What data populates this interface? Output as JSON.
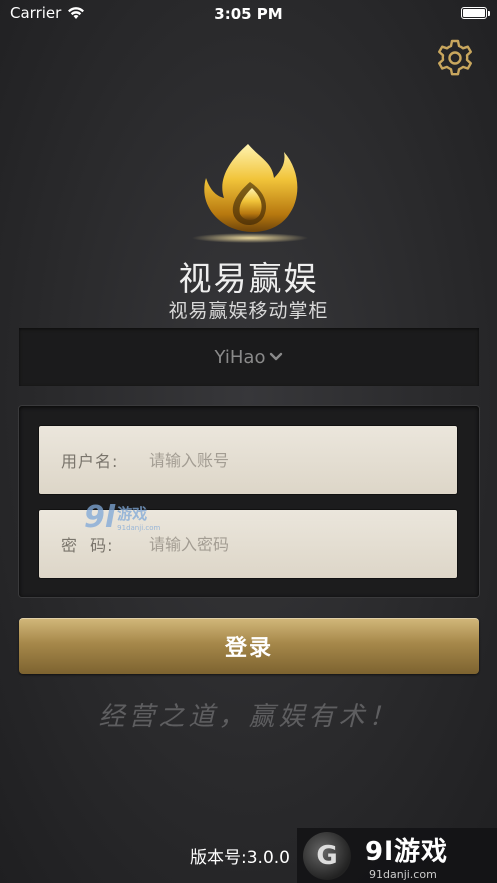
{
  "status_bar": {
    "carrier": "Carrier",
    "time": "3:05 PM"
  },
  "header": {
    "settings_icon": "gear-icon"
  },
  "brand": {
    "logo_icon": "flame-logo",
    "title": "视易赢娱",
    "subtitle": "视易赢娱移动掌柜"
  },
  "company_selector": {
    "value": "YiHao",
    "icon": "chevron-down-icon"
  },
  "login_form": {
    "username_label": "用户名:",
    "username_placeholder": "请输入账号",
    "password_label": "密  码:",
    "password_placeholder": "请输入密码",
    "submit_label": "登录"
  },
  "slogan": "经营之道，赢娱有术！",
  "version": "版本号:3.0.0",
  "watermarks": {
    "overlay_number": "9l",
    "overlay_text": "游戏",
    "overlay_url": "91danji.com",
    "corner_number": "9l",
    "corner_text": "游戏",
    "corner_url": "91danji.com",
    "corner_logo_letter": "G"
  },
  "colors": {
    "background": "#2b2b2d",
    "gold_button": "#a6884a",
    "input_bg": "#e7e1d6"
  }
}
